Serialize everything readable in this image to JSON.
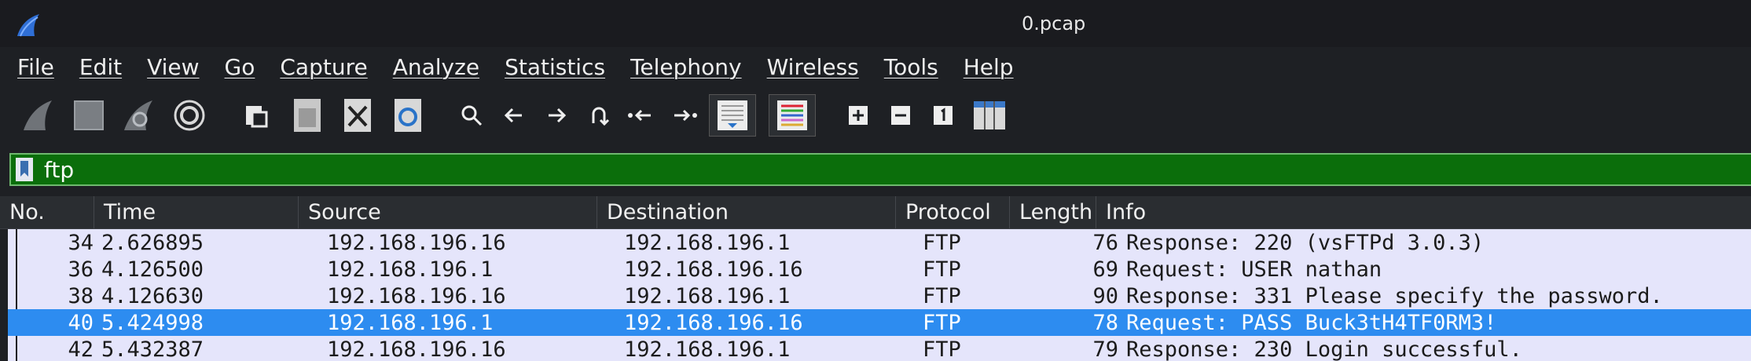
{
  "window": {
    "title": "0.pcap"
  },
  "menu": [
    "File",
    "Edit",
    "View",
    "Go",
    "Capture",
    "Analyze",
    "Statistics",
    "Telephony",
    "Wireless",
    "Tools",
    "Help"
  ],
  "toolbar": {
    "icons": [
      "start-capture-icon",
      "stop-capture-icon",
      "restart-capture-icon",
      "capture-options-icon",
      "open-file-icon",
      "save-file-icon",
      "close-file-icon",
      "reload-file-icon",
      "find-packet-icon",
      "go-back-icon",
      "go-forward-icon",
      "go-to-packet-icon",
      "first-packet-icon",
      "last-packet-icon",
      "autoscroll-icon",
      "colorize-icon",
      "zoom-in-icon",
      "zoom-out-icon",
      "normal-size-icon",
      "resize-columns-icon"
    ]
  },
  "filter": {
    "value": "ftp"
  },
  "packet_list": {
    "columns": [
      "No.",
      "Time",
      "Source",
      "Destination",
      "Protocol",
      "Length",
      "Info"
    ],
    "rows": [
      {
        "no": "34",
        "time": "2.626895",
        "source": "192.168.196.16",
        "destination": "192.168.196.1",
        "protocol": "FTP",
        "length": "76",
        "info": "Response: 220 (vsFTPd 3.0.3)",
        "selected": false
      },
      {
        "no": "36",
        "time": "4.126500",
        "source": "192.168.196.1",
        "destination": "192.168.196.16",
        "protocol": "FTP",
        "length": "69",
        "info": "Request: USER nathan",
        "selected": false
      },
      {
        "no": "38",
        "time": "4.126630",
        "source": "192.168.196.16",
        "destination": "192.168.196.1",
        "protocol": "FTP",
        "length": "90",
        "info": "Response: 331 Please specify the password.",
        "selected": false
      },
      {
        "no": "40",
        "time": "5.424998",
        "source": "192.168.196.1",
        "destination": "192.168.196.16",
        "protocol": "FTP",
        "length": "78",
        "info": "Request: PASS Buck3tH4TF0RM3!",
        "selected": true
      },
      {
        "no": "42",
        "time": "5.432387",
        "source": "192.168.196.16",
        "destination": "192.168.196.1",
        "protocol": "FTP",
        "length": "79",
        "info": "Response: 230 Login successful.",
        "selected": false
      }
    ]
  },
  "colors": {
    "filter_valid": "#0b6e0b",
    "row_bg": "#e5e5fb",
    "row_selected": "#2d8cf0"
  }
}
